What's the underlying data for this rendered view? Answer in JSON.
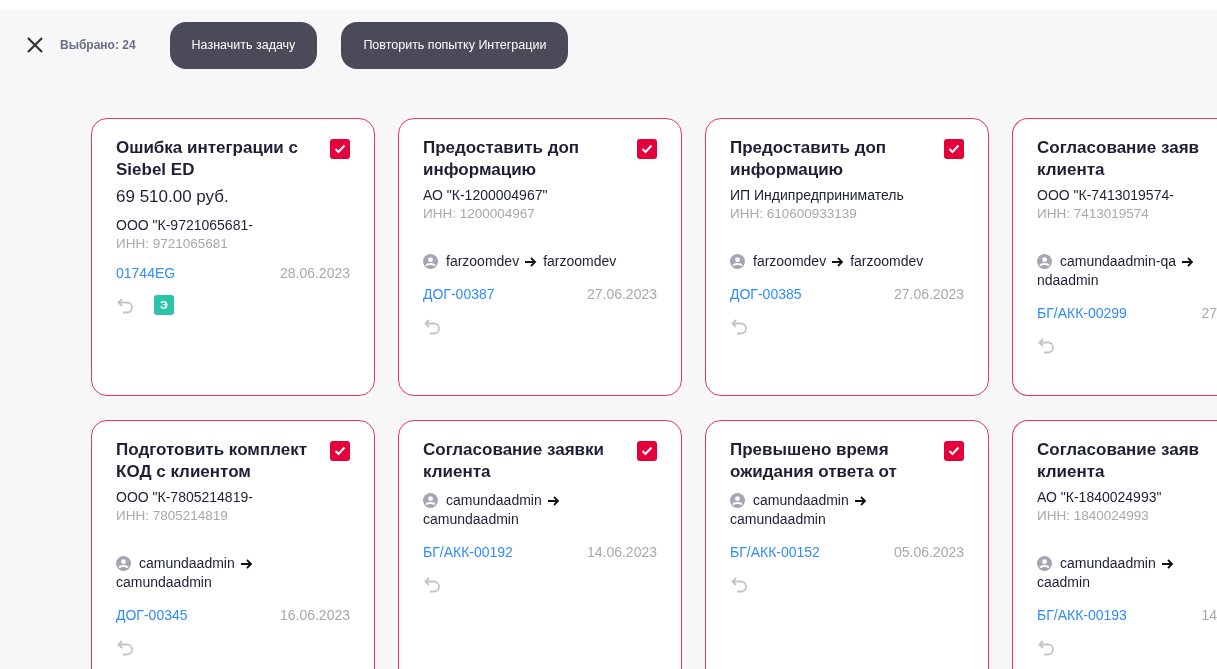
{
  "toolbar": {
    "selected_count": "Выбрано: 24",
    "buttons": [
      "Назначить задачу",
      "Повторить попытку Интеграции"
    ]
  },
  "cards": [
    {
      "title": "Ошибка интеграции с Siebel ED",
      "checked": true,
      "amount": "69 510.00 руб.",
      "org": "ООО \"К-9721065681-",
      "inn": "ИНН: 9721065681",
      "doc": "01744EG",
      "date": "28.06.2023",
      "badge": "Э"
    },
    {
      "title": "Предоставить доп информацию",
      "checked": true,
      "org": "АО \"К-1200004967\"",
      "inn": "ИНН: 1200004967",
      "from": "farzoomdev",
      "to": "farzoomdev",
      "doc": "ДОГ-00387",
      "date": "27.06.2023"
    },
    {
      "title": "Предоставить доп информацию",
      "checked": true,
      "org": "ИП Индипредприниматель",
      "inn": "ИНН: 610600933139",
      "from": "farzoomdev",
      "to": "farzoomdev",
      "doc": "ДОГ-00385",
      "date": "27.06.2023"
    },
    {
      "title": "Согласование заяв клиента",
      "org": "ООО \"К-7413019574-",
      "inn": "ИНН: 7413019574",
      "from": "camundaadmin-qa",
      "to": "ndaadmin",
      "doc": "БГ/АКК-00299",
      "date": "27"
    },
    {
      "title": "Подготовить комплект КОД с клиентом",
      "checked": true,
      "org": "ООО \"К-7805214819-",
      "inn": "ИНН: 7805214819",
      "from": "camundaadmin",
      "to": "camundaadmin",
      "doc": "ДОГ-00345",
      "date": "16.06.2023"
    },
    {
      "title": "Согласование заявки клиента",
      "checked": true,
      "from": "camundaadmin",
      "to": "camundaadmin",
      "doc": "БГ/АКК-00192",
      "date": "14.06.2023"
    },
    {
      "title": "Превышено время ожидания ответа от",
      "checked": true,
      "from": "camundaadmin",
      "to": "camundaadmin",
      "doc": "БГ/АКК-00152",
      "date": "05.06.2023"
    },
    {
      "title": "Согласование заяв клиента",
      "org": "АО \"К-1840024993\"",
      "inn": "ИНН: 1840024993",
      "from": "camundaadmin",
      "to": "caadmin",
      "doc": "БГ/АКК-00193",
      "date": "14"
    }
  ]
}
